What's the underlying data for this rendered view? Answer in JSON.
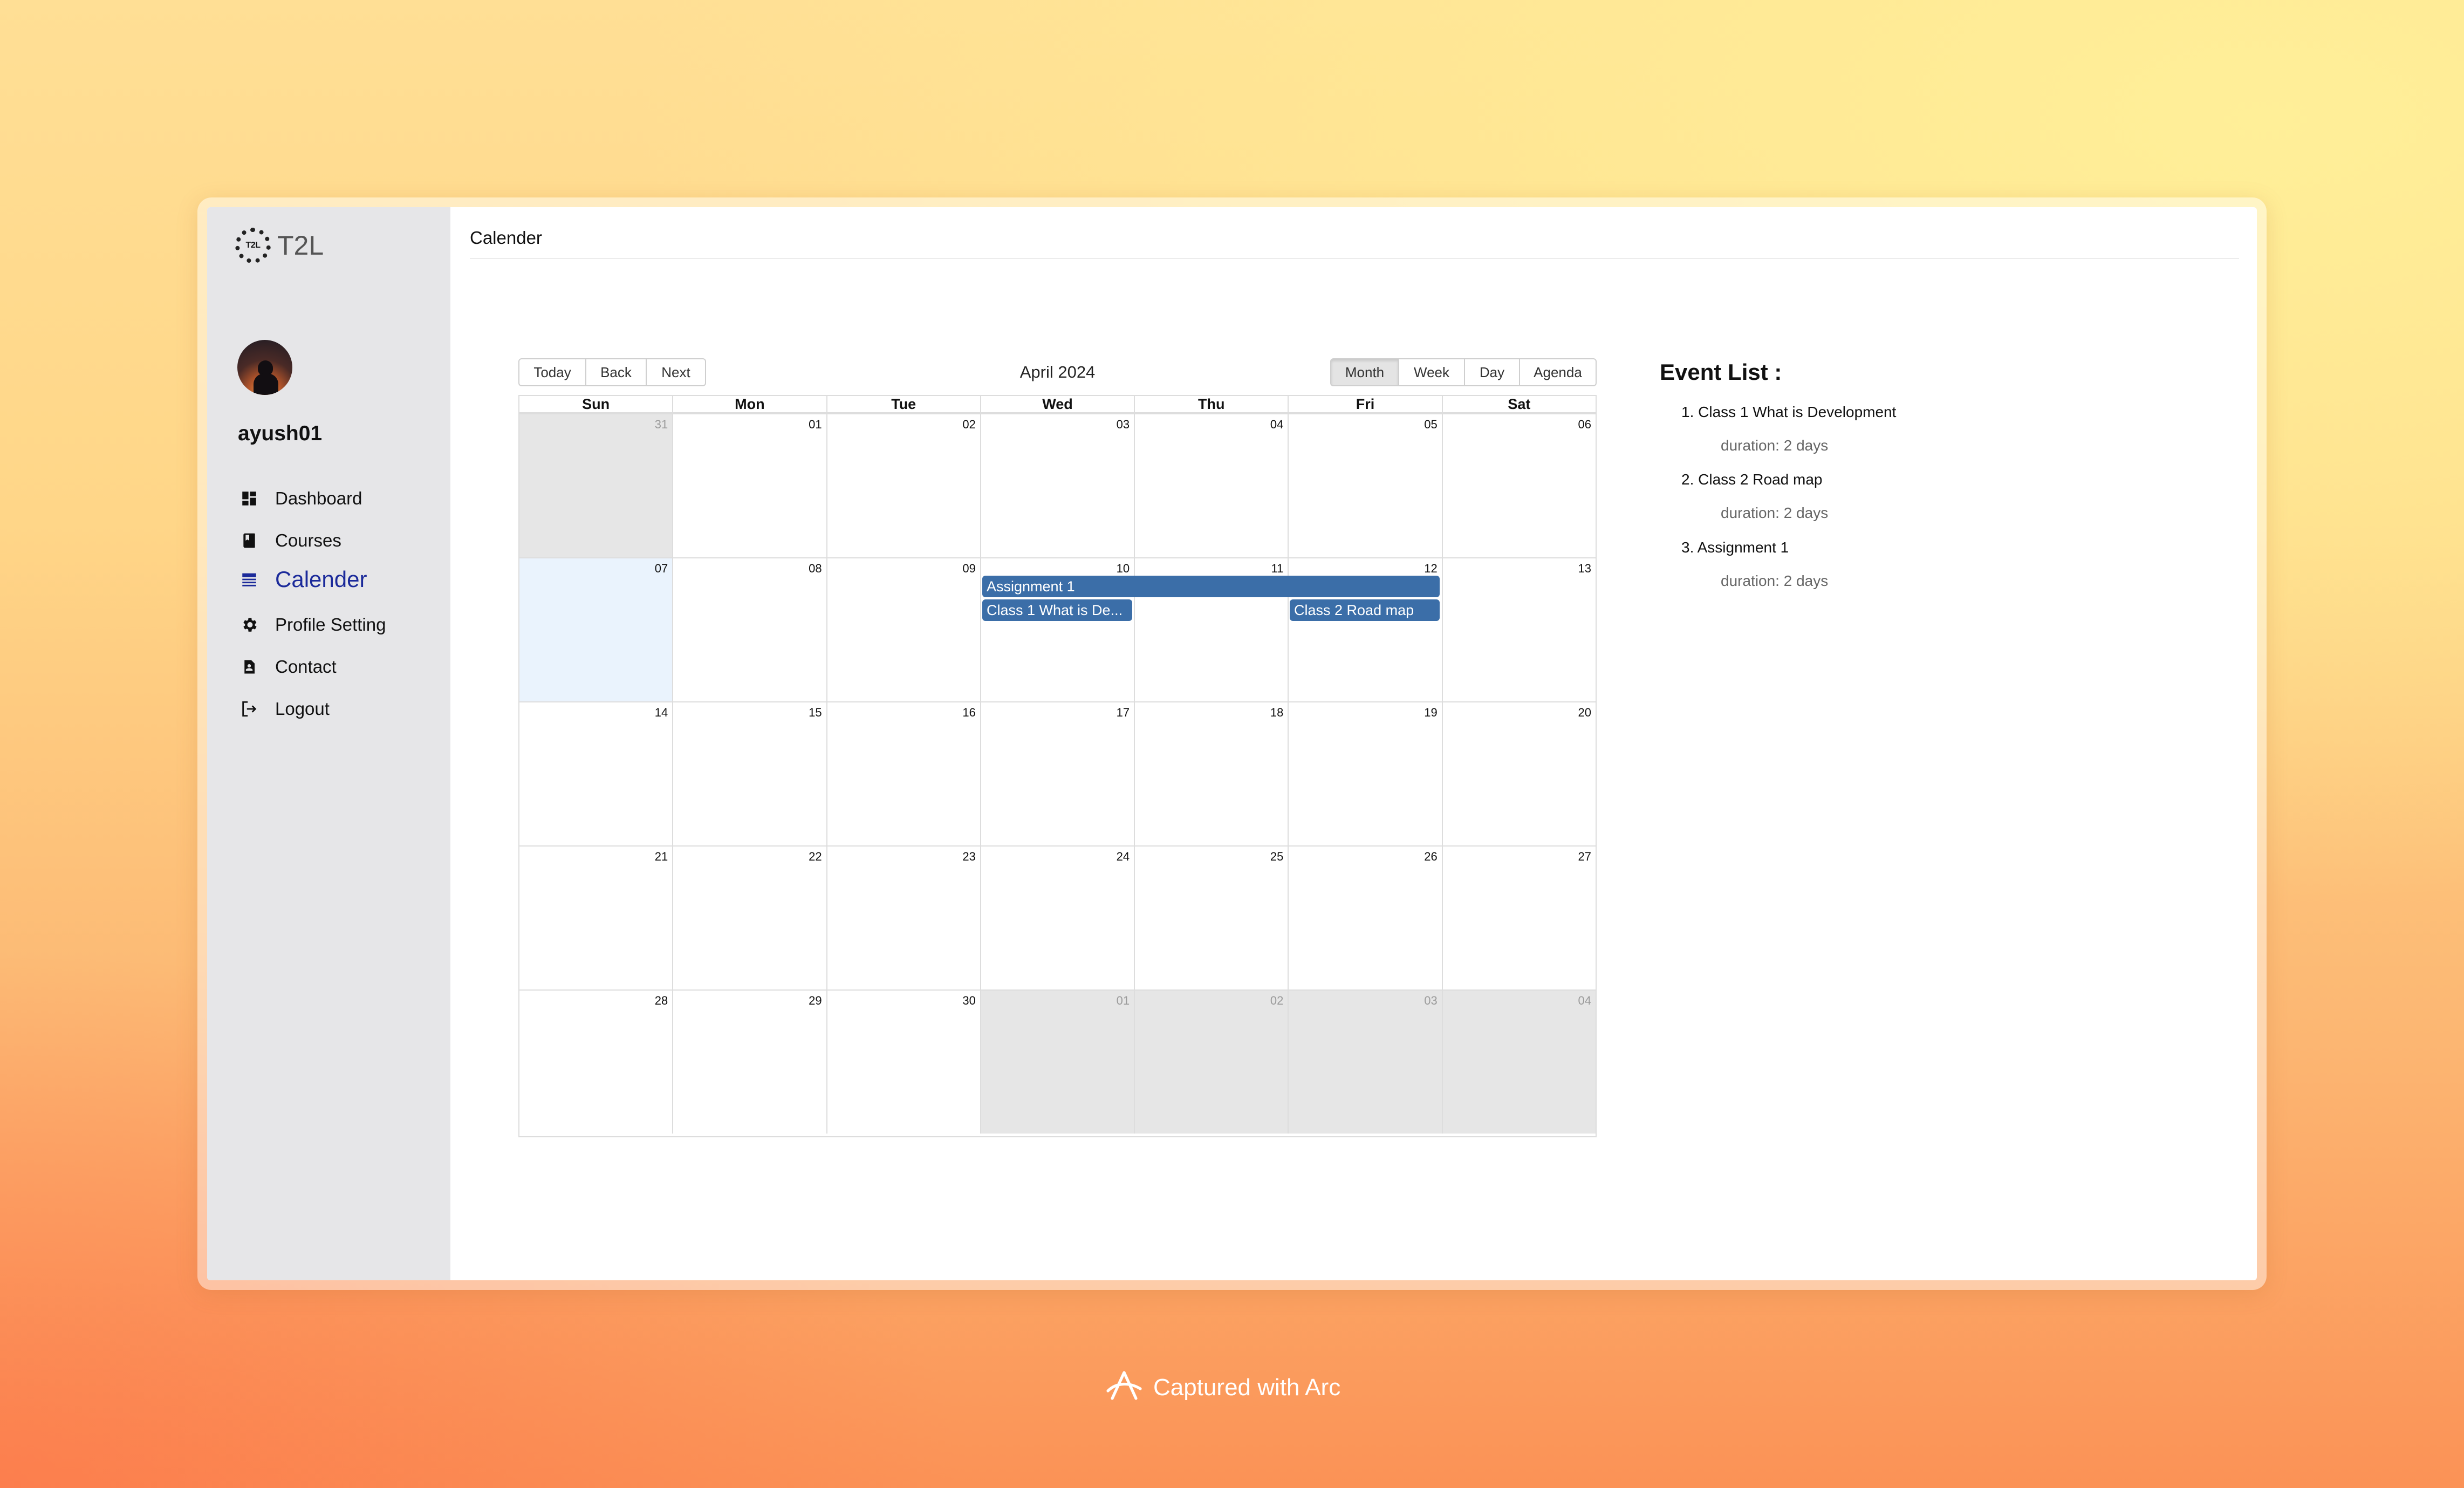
{
  "app": {
    "logo_text": "T2L",
    "logo_mark_text": "T2L"
  },
  "sidebar": {
    "username": "ayush01",
    "items": [
      {
        "label": "Dashboard",
        "icon": "dashboard-icon"
      },
      {
        "label": "Courses",
        "icon": "book-icon"
      },
      {
        "label": "Calender",
        "icon": "calendar-icon",
        "active": true
      },
      {
        "label": "Profile Setting",
        "icon": "gear-icon"
      },
      {
        "label": "Contact",
        "icon": "contact-icon"
      },
      {
        "label": "Logout",
        "icon": "logout-icon"
      }
    ]
  },
  "page": {
    "title": "Calender"
  },
  "calendar": {
    "nav_buttons": [
      "Today",
      "Back",
      "Next"
    ],
    "label": "April 2024",
    "views": [
      "Month",
      "Week",
      "Day",
      "Agenda"
    ],
    "active_view": "Month",
    "weekdays": [
      "Sun",
      "Mon",
      "Tue",
      "Wed",
      "Thu",
      "Fri",
      "Sat"
    ],
    "weeks": [
      [
        "31",
        "01",
        "02",
        "03",
        "04",
        "05",
        "06"
      ],
      [
        "07",
        "08",
        "09",
        "10",
        "11",
        "12",
        "13"
      ],
      [
        "14",
        "15",
        "16",
        "17",
        "18",
        "19",
        "20"
      ],
      [
        "21",
        "22",
        "23",
        "24",
        "25",
        "26",
        "27"
      ],
      [
        "28",
        "29",
        "30",
        "01",
        "02",
        "03",
        "04"
      ]
    ],
    "events": [
      {
        "title": "Assignment 1",
        "display": "Assignment 1"
      },
      {
        "title": "Class 1 What is Development",
        "display": "Class 1 What is De..."
      },
      {
        "title": "Class 2 Road map",
        "display": "Class 2 Road map"
      }
    ],
    "colors": {
      "event": "#3b6ea8",
      "off_range": "#e6e6e6",
      "today": "#eaf3fd"
    }
  },
  "event_list": {
    "title": "Event List :",
    "items": [
      {
        "num": "1.",
        "title": "Class 1 What is Development",
        "duration": "duration: 2 days"
      },
      {
        "num": "2.",
        "title": "Class 2 Road map",
        "duration": "duration: 2 days"
      },
      {
        "num": "3.",
        "title": "Assignment 1",
        "duration": "duration: 2 days"
      }
    ]
  },
  "footer": {
    "captured_text": "Captured with Arc",
    "icon": "arc-icon"
  },
  "theme": {
    "accent": "#1b2a9a",
    "sidebar_bg": "#e6e6e8"
  }
}
